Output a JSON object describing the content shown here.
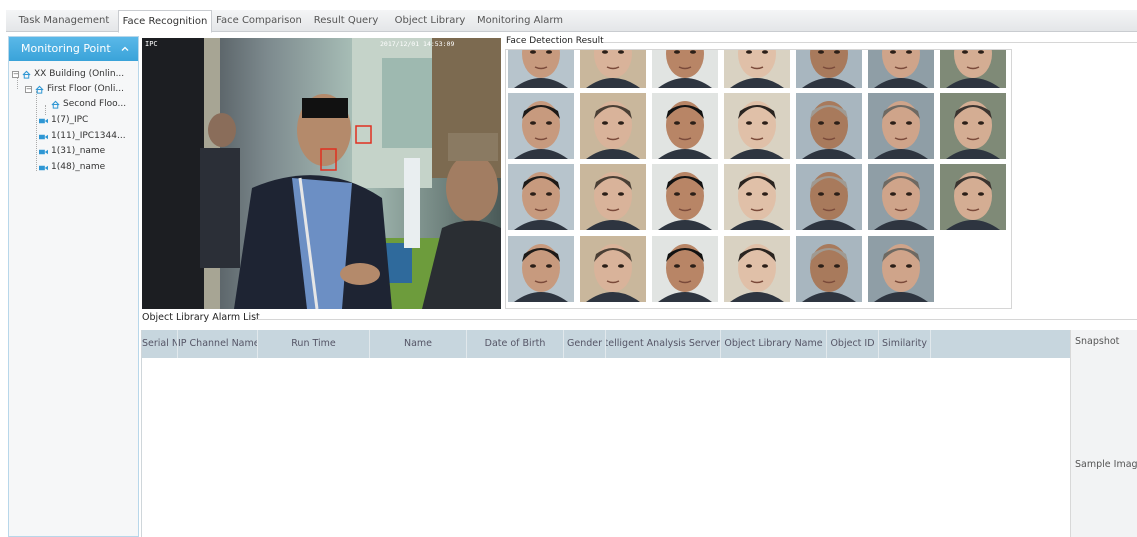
{
  "tabs": [
    {
      "label": "Task Management",
      "active": false
    },
    {
      "label": "Face Recognition",
      "active": true
    },
    {
      "label": "Face Comparison",
      "active": false
    },
    {
      "label": "Result Query",
      "active": false
    },
    {
      "label": "Object Library",
      "active": false
    },
    {
      "label": "Monitoring Alarm",
      "active": false
    }
  ],
  "sidebar": {
    "title": "Monitoring Point",
    "tree": [
      {
        "label": "XX Building (Onlin...",
        "type": "building",
        "expandable": true
      },
      {
        "label": "First Floor (Onli...",
        "type": "floor",
        "expandable": true
      },
      {
        "label": "Second Floo...",
        "type": "floor",
        "expandable": false
      },
      {
        "label": "1(7)_IPC",
        "type": "camera"
      },
      {
        "label": "1(11)_IPC1344...",
        "type": "camera"
      },
      {
        "label": "1(31)_name",
        "type": "camera"
      },
      {
        "label": "1(48)_name",
        "type": "camera"
      }
    ]
  },
  "video": {
    "channel_label": "IPC",
    "timestamp": "2017/12/01 14:53:09"
  },
  "face_detection": {
    "title": "Face Detection Result"
  },
  "alarm_list": {
    "title": "Object Library Alarm List",
    "columns": [
      "Serial No",
      "IP Channel Name",
      "Run Time",
      "Name",
      "Date of Birth",
      "Gender",
      "Intelligent Analysis Server",
      "Object Library Name",
      "Object ID",
      "Similarity"
    ],
    "rows": []
  },
  "side_info": {
    "snapshot_label": "Snapshot",
    "sample_label": "Sample Image"
  },
  "colors": {
    "accent": "#3aa3d9",
    "table_header": "#c7d6de",
    "detection_box": "#e03020"
  }
}
